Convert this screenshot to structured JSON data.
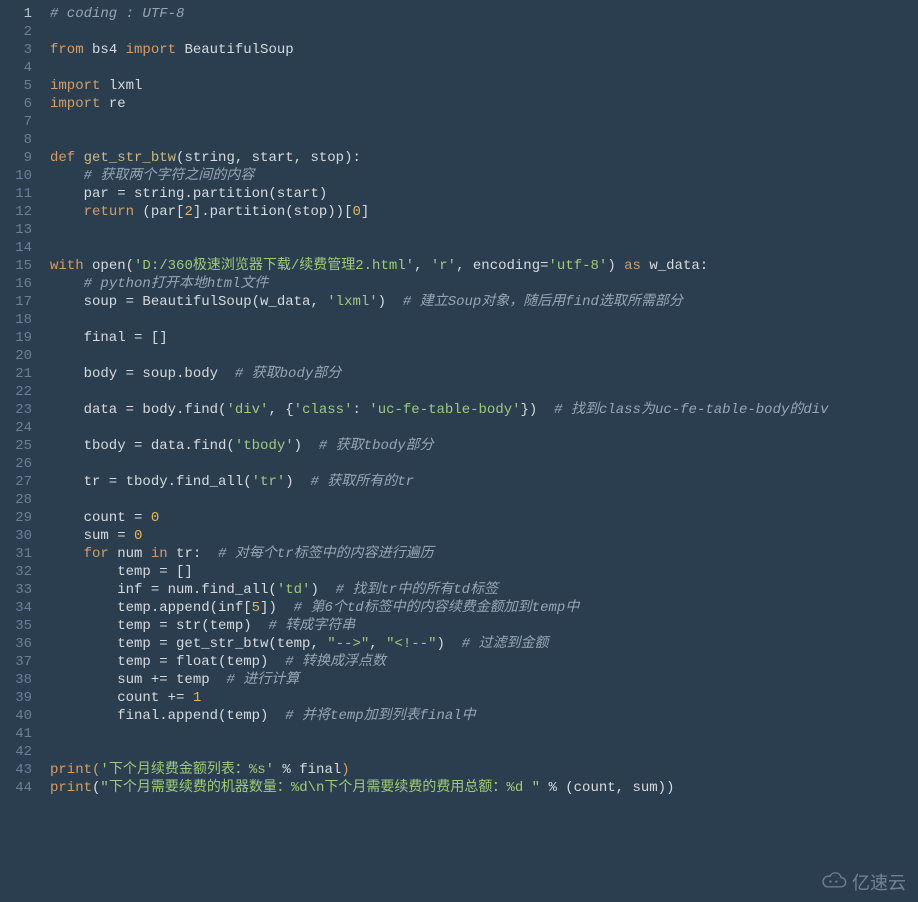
{
  "editor": {
    "colors": {
      "background": "#2b3e50",
      "text": "#d7dadc",
      "gutter_text": "#6a7f95",
      "comment": "#96a6b5",
      "keyword": "#d59d66",
      "string": "#9fca7b",
      "number": "#e2b75a"
    },
    "line_count": 44,
    "lines": [
      {
        "n": 1,
        "tokens": [
          {
            "t": "# coding : UTF-8",
            "c": "c"
          }
        ]
      },
      {
        "n": 2,
        "tokens": []
      },
      {
        "n": 3,
        "tokens": [
          {
            "t": "from",
            "c": "k"
          },
          {
            "t": " bs4 ",
            "c": "d"
          },
          {
            "t": "import",
            "c": "k"
          },
          {
            "t": " BeautifulSoup",
            "c": "d"
          }
        ]
      },
      {
        "n": 4,
        "tokens": []
      },
      {
        "n": 5,
        "tokens": [
          {
            "t": "import",
            "c": "k"
          },
          {
            "t": " lxml",
            "c": "d"
          }
        ]
      },
      {
        "n": 6,
        "tokens": [
          {
            "t": "import",
            "c": "k"
          },
          {
            "t": " re",
            "c": "d"
          }
        ]
      },
      {
        "n": 7,
        "tokens": []
      },
      {
        "n": 8,
        "tokens": []
      },
      {
        "n": 9,
        "tokens": [
          {
            "t": "def",
            "c": "k"
          },
          {
            "t": " ",
            "c": "d"
          },
          {
            "t": "get_str_btw",
            "c": "fn"
          },
          {
            "t": "(string, start, stop):",
            "c": "d"
          }
        ]
      },
      {
        "n": 10,
        "tokens": [
          {
            "t": "    ",
            "c": "d"
          },
          {
            "t": "# 获取两个字符之间的内容",
            "c": "c"
          }
        ]
      },
      {
        "n": 11,
        "tokens": [
          {
            "t": "    par = string.partition(start)",
            "c": "d"
          }
        ]
      },
      {
        "n": 12,
        "tokens": [
          {
            "t": "    ",
            "c": "d"
          },
          {
            "t": "return",
            "c": "k"
          },
          {
            "t": " (par[",
            "c": "d"
          },
          {
            "t": "2",
            "c": "n"
          },
          {
            "t": "].partition(stop))[",
            "c": "d"
          },
          {
            "t": "0",
            "c": "n"
          },
          {
            "t": "]",
            "c": "d"
          }
        ]
      },
      {
        "n": 13,
        "tokens": []
      },
      {
        "n": 14,
        "tokens": []
      },
      {
        "n": 15,
        "tokens": [
          {
            "t": "with",
            "c": "k"
          },
          {
            "t": " open(",
            "c": "d"
          },
          {
            "t": "'D:/360极速浏览器下载/续费管理2.html'",
            "c": "s"
          },
          {
            "t": ", ",
            "c": "d"
          },
          {
            "t": "'r'",
            "c": "s"
          },
          {
            "t": ", encoding=",
            "c": "d"
          },
          {
            "t": "'utf-8'",
            "c": "s"
          },
          {
            "t": ") ",
            "c": "d"
          },
          {
            "t": "as",
            "c": "k"
          },
          {
            "t": " w_data:",
            "c": "d"
          }
        ]
      },
      {
        "n": 16,
        "tokens": [
          {
            "t": "    ",
            "c": "d"
          },
          {
            "t": "# python打开本地html文件",
            "c": "c"
          }
        ]
      },
      {
        "n": 17,
        "tokens": [
          {
            "t": "    soup = BeautifulSoup(w_data, ",
            "c": "d"
          },
          {
            "t": "'lxml'",
            "c": "s"
          },
          {
            "t": ")  ",
            "c": "d"
          },
          {
            "t": "# 建立Soup对象，随后用find选取所需部分",
            "c": "c"
          }
        ]
      },
      {
        "n": 18,
        "tokens": []
      },
      {
        "n": 19,
        "tokens": [
          {
            "t": "    final = []",
            "c": "d"
          }
        ]
      },
      {
        "n": 20,
        "tokens": []
      },
      {
        "n": 21,
        "tokens": [
          {
            "t": "    body = soup.body  ",
            "c": "d"
          },
          {
            "t": "# 获取body部分",
            "c": "c"
          }
        ]
      },
      {
        "n": 22,
        "tokens": []
      },
      {
        "n": 23,
        "tokens": [
          {
            "t": "    data = body.find(",
            "c": "d"
          },
          {
            "t": "'div'",
            "c": "s"
          },
          {
            "t": ", {",
            "c": "d"
          },
          {
            "t": "'class'",
            "c": "s"
          },
          {
            "t": ": ",
            "c": "d"
          },
          {
            "t": "'uc-fe-table-body'",
            "c": "s"
          },
          {
            "t": "})  ",
            "c": "d"
          },
          {
            "t": "# 找到class为uc-fe-table-body的div",
            "c": "c"
          }
        ]
      },
      {
        "n": 24,
        "tokens": []
      },
      {
        "n": 25,
        "tokens": [
          {
            "t": "    tbody = data.find(",
            "c": "d"
          },
          {
            "t": "'tbody'",
            "c": "s"
          },
          {
            "t": ")  ",
            "c": "d"
          },
          {
            "t": "# 获取tbody部分",
            "c": "c"
          }
        ]
      },
      {
        "n": 26,
        "tokens": []
      },
      {
        "n": 27,
        "tokens": [
          {
            "t": "    tr = tbody.find_all(",
            "c": "d"
          },
          {
            "t": "'tr'",
            "c": "s"
          },
          {
            "t": ")  ",
            "c": "d"
          },
          {
            "t": "# 获取所有的tr",
            "c": "c"
          }
        ]
      },
      {
        "n": 28,
        "tokens": []
      },
      {
        "n": 29,
        "tokens": [
          {
            "t": "    count = ",
            "c": "d"
          },
          {
            "t": "0",
            "c": "n"
          }
        ]
      },
      {
        "n": 30,
        "tokens": [
          {
            "t": "    sum = ",
            "c": "d"
          },
          {
            "t": "0",
            "c": "n"
          }
        ]
      },
      {
        "n": 31,
        "tokens": [
          {
            "t": "    ",
            "c": "d"
          },
          {
            "t": "for",
            "c": "k"
          },
          {
            "t": " num ",
            "c": "d"
          },
          {
            "t": "in",
            "c": "k"
          },
          {
            "t": " tr:  ",
            "c": "d"
          },
          {
            "t": "# 对每个tr标签中的内容进行遍历",
            "c": "c"
          }
        ]
      },
      {
        "n": 32,
        "tokens": [
          {
            "t": "        temp = []",
            "c": "d"
          }
        ]
      },
      {
        "n": 33,
        "tokens": [
          {
            "t": "        inf = num.find_all(",
            "c": "d"
          },
          {
            "t": "'td'",
            "c": "s"
          },
          {
            "t": ")  ",
            "c": "d"
          },
          {
            "t": "# 找到tr中的所有td标签",
            "c": "c"
          }
        ]
      },
      {
        "n": 34,
        "tokens": [
          {
            "t": "        temp.append(inf[",
            "c": "d"
          },
          {
            "t": "5",
            "c": "n"
          },
          {
            "t": "])  ",
            "c": "d"
          },
          {
            "t": "# 第6个td标签中的内容续费金额加到temp中",
            "c": "c"
          }
        ]
      },
      {
        "n": 35,
        "tokens": [
          {
            "t": "        temp = str(temp)  ",
            "c": "d"
          },
          {
            "t": "# 转成字符串",
            "c": "c"
          }
        ]
      },
      {
        "n": 36,
        "tokens": [
          {
            "t": "        temp = get_str_btw(temp, ",
            "c": "d"
          },
          {
            "t": "\"-->\"",
            "c": "s"
          },
          {
            "t": ", ",
            "c": "d"
          },
          {
            "t": "\"<!--\"",
            "c": "s"
          },
          {
            "t": ")  ",
            "c": "d"
          },
          {
            "t": "# 过滤到金额",
            "c": "c"
          }
        ]
      },
      {
        "n": 37,
        "tokens": [
          {
            "t": "        temp = float(temp)  ",
            "c": "d"
          },
          {
            "t": "# 转换成浮点数",
            "c": "c"
          }
        ]
      },
      {
        "n": 38,
        "tokens": [
          {
            "t": "        sum += temp  ",
            "c": "d"
          },
          {
            "t": "# 进行计算",
            "c": "c"
          }
        ]
      },
      {
        "n": 39,
        "tokens": [
          {
            "t": "        count += ",
            "c": "d"
          },
          {
            "t": "1",
            "c": "n"
          }
        ]
      },
      {
        "n": 40,
        "tokens": [
          {
            "t": "        final.append(temp)  ",
            "c": "d"
          },
          {
            "t": "# 并将temp加到列表final中",
            "c": "c"
          }
        ]
      },
      {
        "n": 41,
        "tokens": []
      },
      {
        "n": 42,
        "tokens": []
      },
      {
        "n": 43,
        "tokens": [
          {
            "t": "print",
            "c": "k"
          },
          {
            "t": "(",
            "c": "p"
          },
          {
            "t": "'下个月续费金额列表：%s'",
            "c": "s"
          },
          {
            "t": " % final",
            "c": "d"
          },
          {
            "t": ")",
            "c": "p"
          }
        ]
      },
      {
        "n": 44,
        "tokens": [
          {
            "t": "print",
            "c": "k"
          },
          {
            "t": "(",
            "c": "d"
          },
          {
            "t": "\"下个月需要续费的机器数量：%d\\n下个月需要续费的费用总额：%d \"",
            "c": "s"
          },
          {
            "t": " % (count, sum))",
            "c": "d"
          }
        ]
      }
    ]
  },
  "watermark": {
    "text": "亿速云",
    "icon": "cloud-icon"
  }
}
